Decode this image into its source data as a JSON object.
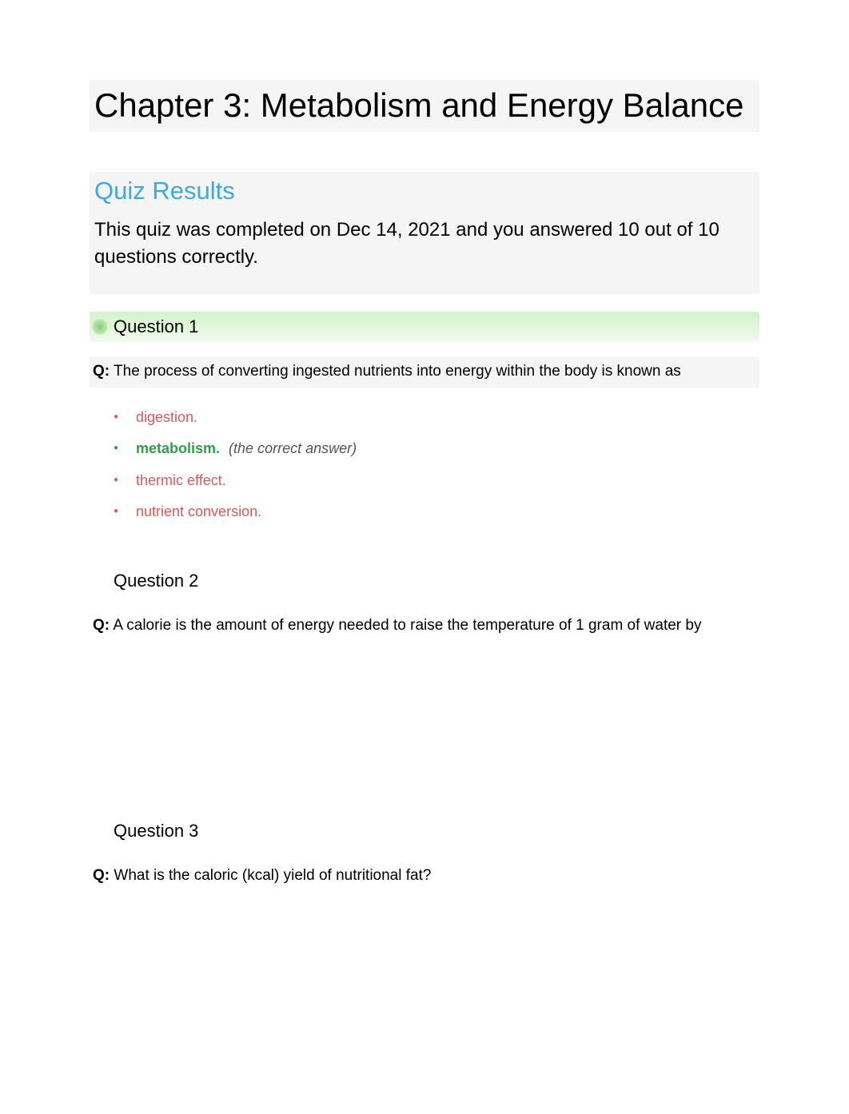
{
  "chapter_title": "Chapter 3: Metabolism and Energy Balance",
  "results_heading": "Quiz Results",
  "summary": "This quiz was completed on Dec 14, 2021 and you answered 10 out of 10 questions correctly.",
  "q_label": "Q:",
  "correct_note": "(the correct answer)",
  "questions": [
    {
      "heading": "Question 1",
      "prompt": "The process of converting ingested nutrients into energy within the body is known as",
      "highlighted": true,
      "answers": [
        {
          "text": "digestion.",
          "correct": false
        },
        {
          "text": "metabolism.",
          "correct": true
        },
        {
          "text": "thermic effect.",
          "correct": false
        },
        {
          "text": "nutrient conversion.",
          "correct": false
        }
      ]
    },
    {
      "heading": "Question 2",
      "prompt": "A calorie is the amount of energy needed to raise the temperature of 1 gram of water by",
      "highlighted": false,
      "answers": []
    },
    {
      "heading": "Question 3",
      "prompt": "What is the caloric (kcal) yield of nutritional fat?",
      "highlighted": false,
      "answers": []
    }
  ]
}
